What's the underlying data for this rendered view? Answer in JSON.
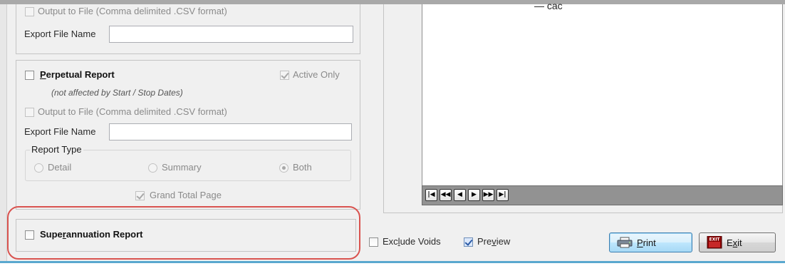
{
  "top_section": {
    "output_to_file_label": "Output to File (Comma delimited .CSV format)",
    "export_file_name_label": "Export File Name",
    "export_file_name_value": ""
  },
  "perpetual": {
    "title_prefix": "P",
    "title_rest": "erpetual Report",
    "note": "(not affected by Start / Stop Dates)",
    "active_only_label": "Active Only",
    "output_to_file_label": "Output to File (Comma delimited .CSV format)",
    "export_file_name_label": "Export File Name",
    "export_file_name_value": "",
    "report_type": {
      "legend": "Report Type",
      "options": [
        "Detail",
        "Summary",
        "Both"
      ],
      "selected": "Both"
    },
    "grand_total_label": "Grand Total Page"
  },
  "superannuation": {
    "label_a": "Supe",
    "label_u": "r",
    "label_b": "annuation Report"
  },
  "preview": {
    "top_glyph": "— сас"
  },
  "navigation": {
    "first": "|◀",
    "prev_page": "◀◀",
    "prev": "◀",
    "next": "▶",
    "next_page": "▶▶",
    "last": "▶|"
  },
  "footer": {
    "exclude_voids_a": "Exc",
    "exclude_voids_u": "l",
    "exclude_voids_b": "ude Voids",
    "preview_a": "Pre",
    "preview_u": "v",
    "preview_b": "iew",
    "print_u": "P",
    "print_b": "rint",
    "exit_a": "E",
    "exit_u": "x",
    "exit_b": "it",
    "exit_icon_text": "EXIT"
  },
  "colors": {
    "highlight": "#d9534f",
    "accent": "#5aa8cf"
  }
}
